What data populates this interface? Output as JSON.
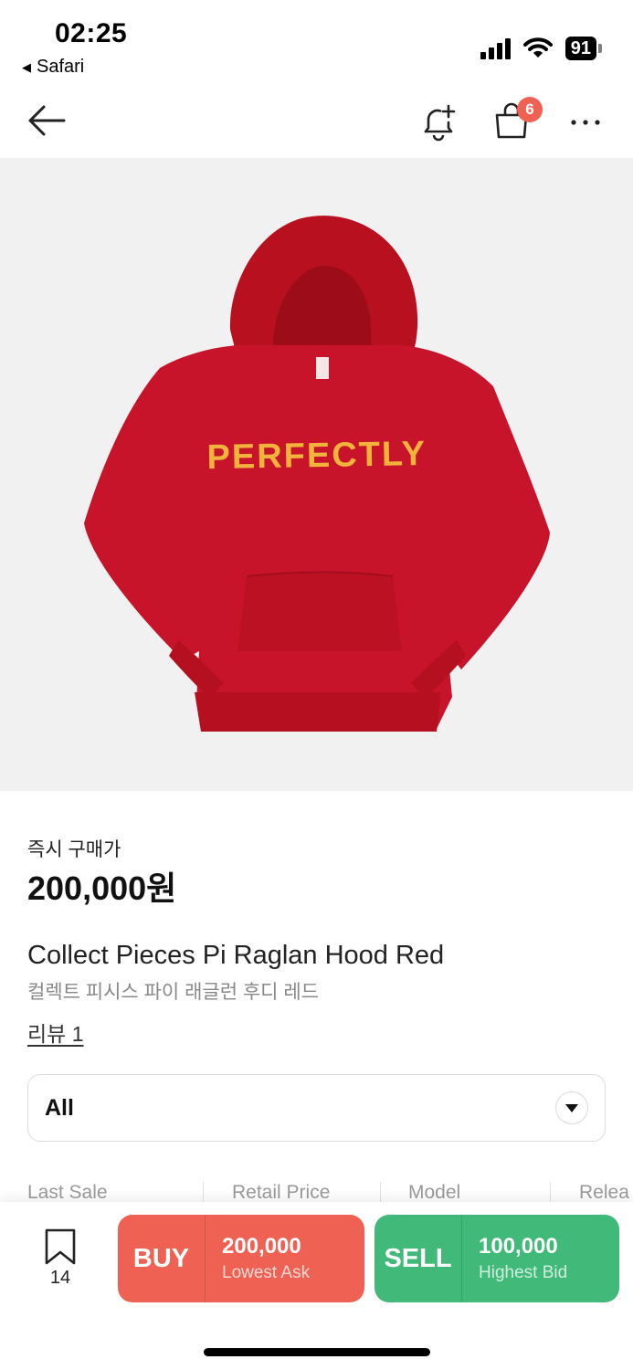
{
  "status_bar": {
    "time": "02:25",
    "back_app": "Safari",
    "battery": "91"
  },
  "nav": {
    "cart_count": "6",
    "icons": [
      "back-arrow-icon",
      "bell-plus-icon",
      "shopping-bag-icon",
      "more-icon"
    ]
  },
  "product": {
    "image_text": "PERFECTLY",
    "buy_now_label": "즉시 구매가",
    "price": "200,000원",
    "name_en": "Collect Pieces Pi Raglan Hood Red",
    "name_ko": "컬렉트 피시스 파이 래글런 후디 레드",
    "review_link": "리뷰 1",
    "size_select": "All"
  },
  "specs": {
    "headers": [
      "Last Sale",
      "Retail Price",
      "Model",
      "Relea"
    ]
  },
  "bottom_bar": {
    "bookmark_count": "14",
    "buy": {
      "label": "BUY",
      "amount": "200,000",
      "sub": "Lowest Ask"
    },
    "sell": {
      "label": "SELL",
      "amount": "100,000",
      "sub": "Highest Bid"
    }
  },
  "colors": {
    "buy": "#ef6253",
    "sell": "#41b979",
    "hoodie": "#c8142a",
    "lettering": "#f2b33d",
    "image_bg": "#f1f1f1"
  }
}
